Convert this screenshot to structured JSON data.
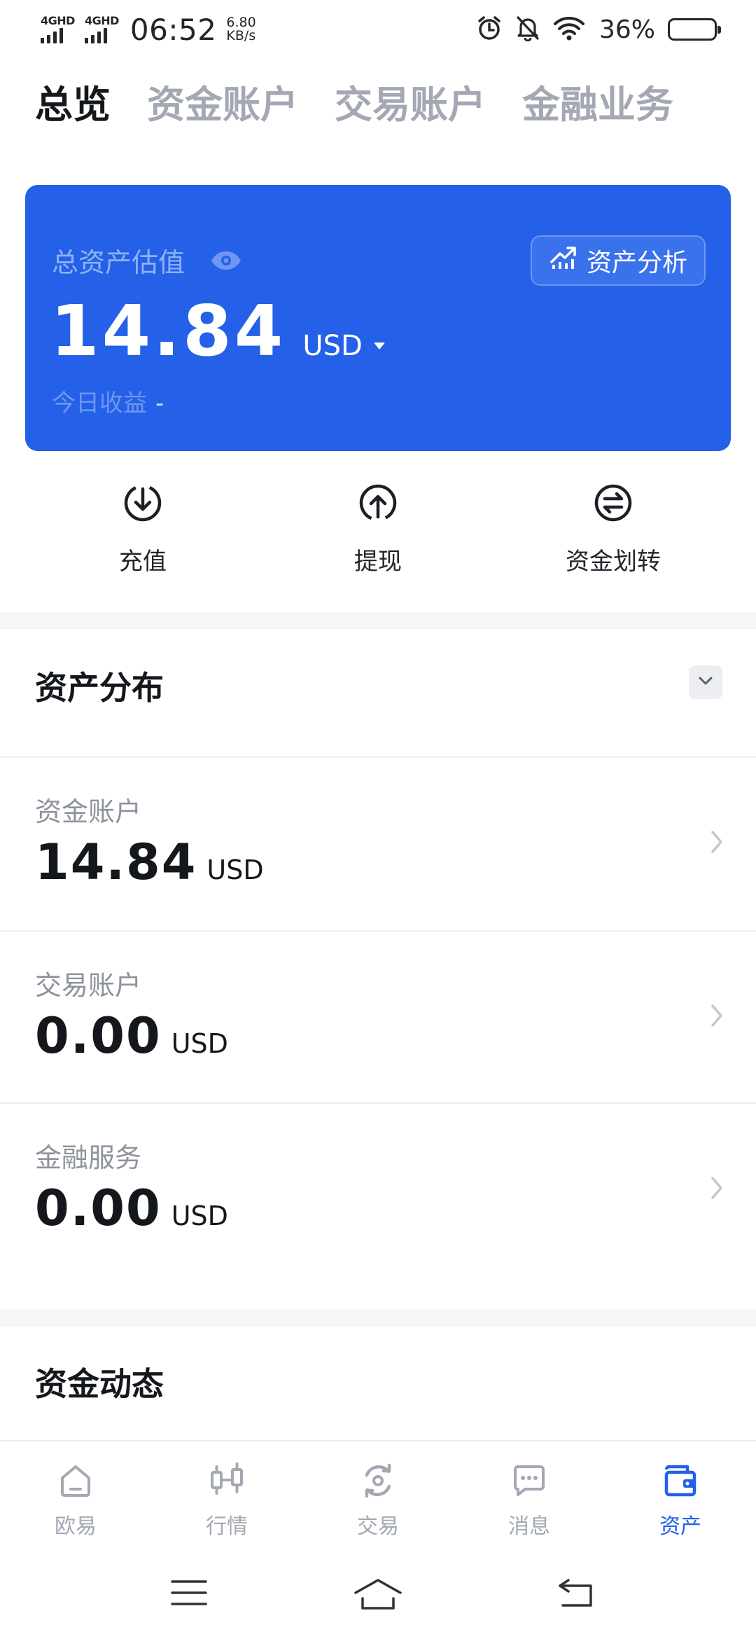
{
  "status_bar": {
    "signal1": "4GHD",
    "signal2": "4GHD",
    "time": "06:52",
    "net_speed_value": "6.80",
    "net_speed_unit": "KB/s",
    "battery": "36%",
    "battery_level": 0.36,
    "icons": [
      "alarm-icon",
      "mute-icon",
      "wifi-icon",
      "battery-icon"
    ]
  },
  "top_tabs": [
    {
      "label": "总览",
      "active": true
    },
    {
      "label": "资金账户",
      "active": false
    },
    {
      "label": "交易账户",
      "active": false
    },
    {
      "label": "金融业务",
      "active": false
    }
  ],
  "asset_card": {
    "label": "总资产估值",
    "amount": "14.84",
    "currency": "USD",
    "today_label": "今日收益",
    "today_value": "-",
    "analysis_label": "资产分析",
    "bg_color": "#2460e8"
  },
  "quick_actions": [
    {
      "label": "充值",
      "icon": "deposit-icon"
    },
    {
      "label": "提现",
      "icon": "withdraw-icon"
    },
    {
      "label": "资金划转",
      "icon": "transfer-icon"
    }
  ],
  "distribution": {
    "title": "资产分布",
    "accounts": [
      {
        "name": "资金账户",
        "amount": "14.84",
        "currency": "USD"
      },
      {
        "name": "交易账户",
        "amount": "0.00",
        "currency": "USD"
      },
      {
        "name": "金融服务",
        "amount": "0.00",
        "currency": "USD"
      }
    ]
  },
  "fund_activity": {
    "title": "资金动态"
  },
  "bottom_nav": [
    {
      "label": "欧易",
      "icon": "home-icon",
      "active": false
    },
    {
      "label": "行情",
      "icon": "candlestick-icon",
      "active": false
    },
    {
      "label": "交易",
      "icon": "trade-icon",
      "active": false
    },
    {
      "label": "消息",
      "icon": "message-icon",
      "active": false
    },
    {
      "label": "资产",
      "icon": "wallet-icon",
      "active": true
    }
  ],
  "accent_color": "#2460e8"
}
